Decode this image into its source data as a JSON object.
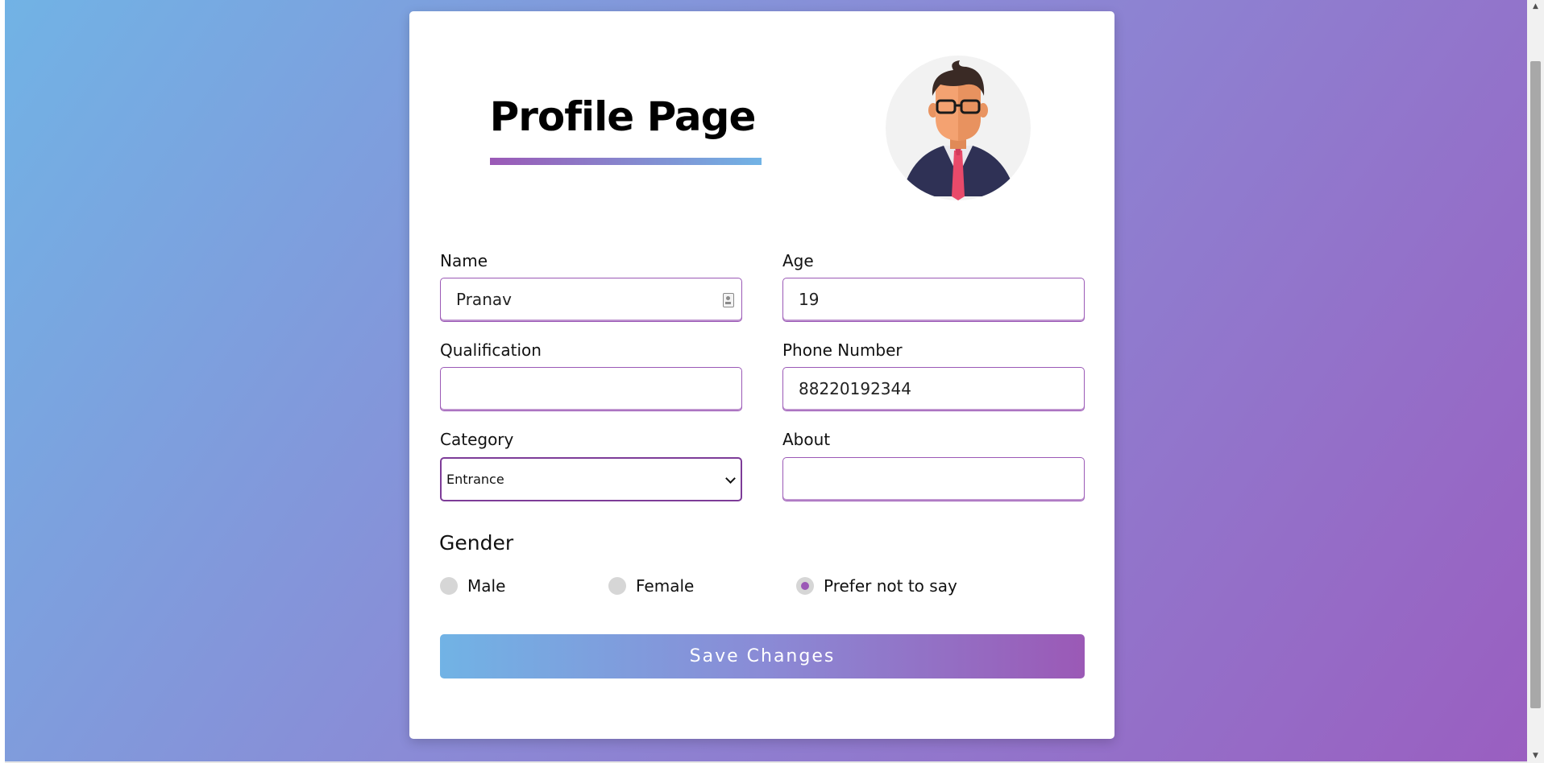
{
  "page": {
    "title": "Profile Page"
  },
  "form": {
    "name": {
      "label": "Name",
      "value": "Pranav"
    },
    "age": {
      "label": "Age",
      "value": "19"
    },
    "qualification": {
      "label": "Qualification",
      "value": ""
    },
    "phone": {
      "label": "Phone Number",
      "value": "88220192344"
    },
    "category": {
      "label": "Category",
      "value": "Entrance"
    },
    "about": {
      "label": "About",
      "value": ""
    }
  },
  "gender": {
    "title": "Gender",
    "options": [
      {
        "label": "Male",
        "checked": false
      },
      {
        "label": "Female",
        "checked": false
      },
      {
        "label": "Prefer not to say",
        "checked": true
      }
    ]
  },
  "actions": {
    "save_label": "Save Changes"
  },
  "icons": {
    "avatar": "businessman-avatar-icon",
    "contact": "contact-card-icon",
    "chevron": "chevron-down-icon"
  },
  "colors": {
    "accent_purple": "#9b59b6",
    "accent_blue": "#71b3e5"
  }
}
